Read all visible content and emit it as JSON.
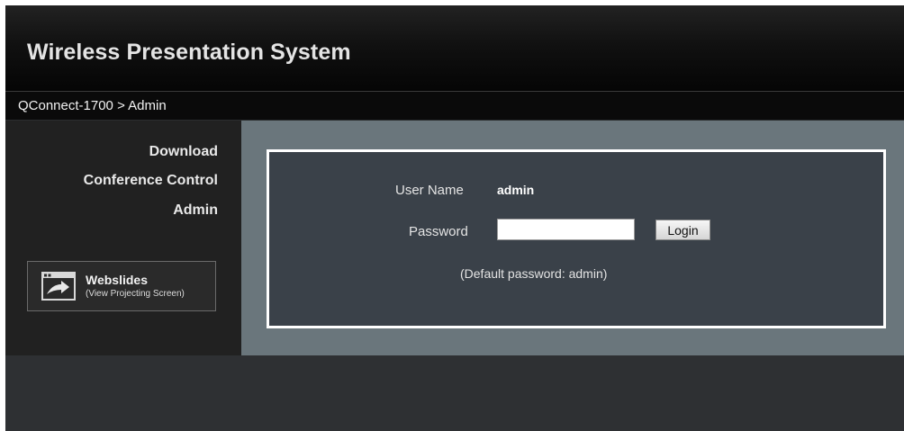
{
  "header": {
    "title": "Wireless Presentation System"
  },
  "breadcrumb": "QConnect-1700 > Admin",
  "sidebar": {
    "items": [
      {
        "label": "Download"
      },
      {
        "label": "Conference Control"
      },
      {
        "label": "Admin"
      }
    ],
    "webslides": {
      "title": "Webslides",
      "subtitle": "(View Projecting Screen)",
      "icon": "screen-arrow-icon"
    }
  },
  "login": {
    "username_label": "User Name",
    "username_value": "admin",
    "password_label": "Password",
    "password_value": "",
    "login_button": "Login",
    "hint": "(Default password: admin)"
  },
  "colors": {
    "header_bg": "#111111",
    "sidebar_bg": "#212121",
    "content_bg": "#6a767c",
    "panel_bg": "#3a4149",
    "panel_border": "#ffffff"
  }
}
